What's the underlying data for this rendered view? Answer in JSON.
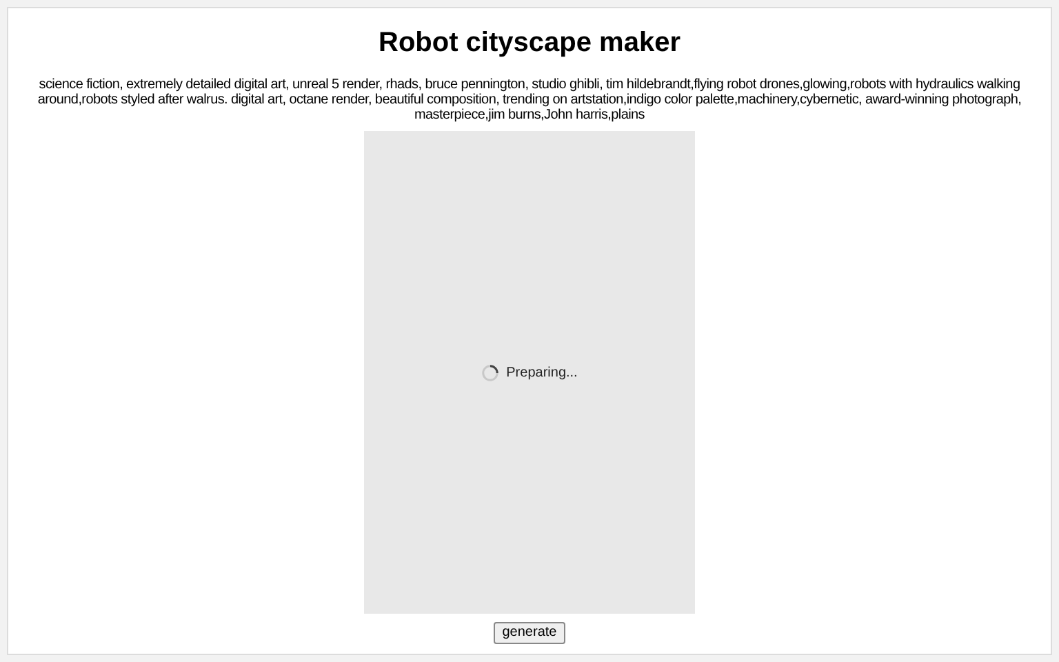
{
  "title": "Robot cityscape maker",
  "prompt": "science fiction, extremely detailed digital art, unreal 5 render, rhads, bruce pennington, studio ghibli, tim hildebrandt,flying robot drones,glowing,robots with hydraulics walking around,robots styled after walrus. digital art, octane render, beautiful composition, trending on artstation,indigo color palette,machinery,cybernetic, award-winning photograph, masterpiece,jim burns,John harris,plains",
  "status": "Preparing...",
  "button": "generate"
}
